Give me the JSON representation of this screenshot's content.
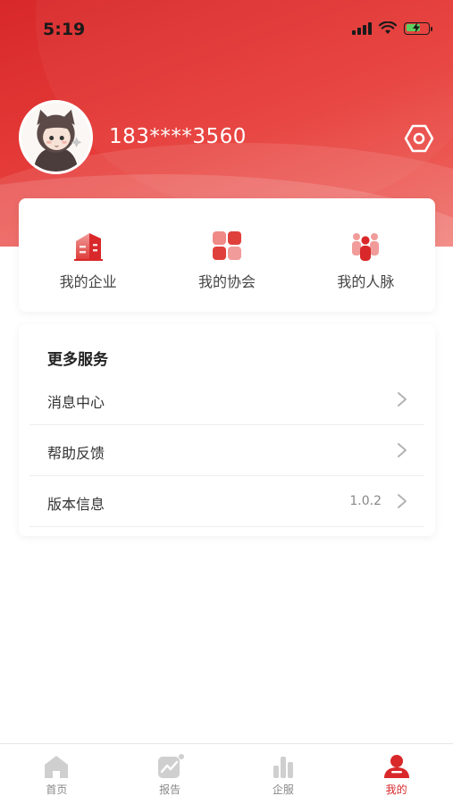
{
  "status_bar": {
    "time": "5:19"
  },
  "profile": {
    "phone": "183****3560"
  },
  "quick_actions": [
    {
      "label": "我的企业",
      "icon": "building-icon"
    },
    {
      "label": "我的协会",
      "icon": "grid-icon"
    },
    {
      "label": "我的人脉",
      "icon": "people-icon"
    }
  ],
  "services": {
    "title": "更多服务",
    "items": [
      {
        "label": "消息中心",
        "value": ""
      },
      {
        "label": "帮助反馈",
        "value": ""
      },
      {
        "label": "版本信息",
        "value": "1.0.2"
      }
    ]
  },
  "tabbar": {
    "items": [
      {
        "label": "首页",
        "icon": "home-icon",
        "active": false
      },
      {
        "label": "报告",
        "icon": "report-icon",
        "active": false
      },
      {
        "label": "企服",
        "icon": "chart-icon",
        "active": false
      },
      {
        "label": "我的",
        "icon": "user-icon",
        "active": true
      }
    ]
  },
  "colors": {
    "accent": "#d9282a",
    "header": "#e23a35",
    "inactive_icon": "#cfcfcf"
  }
}
